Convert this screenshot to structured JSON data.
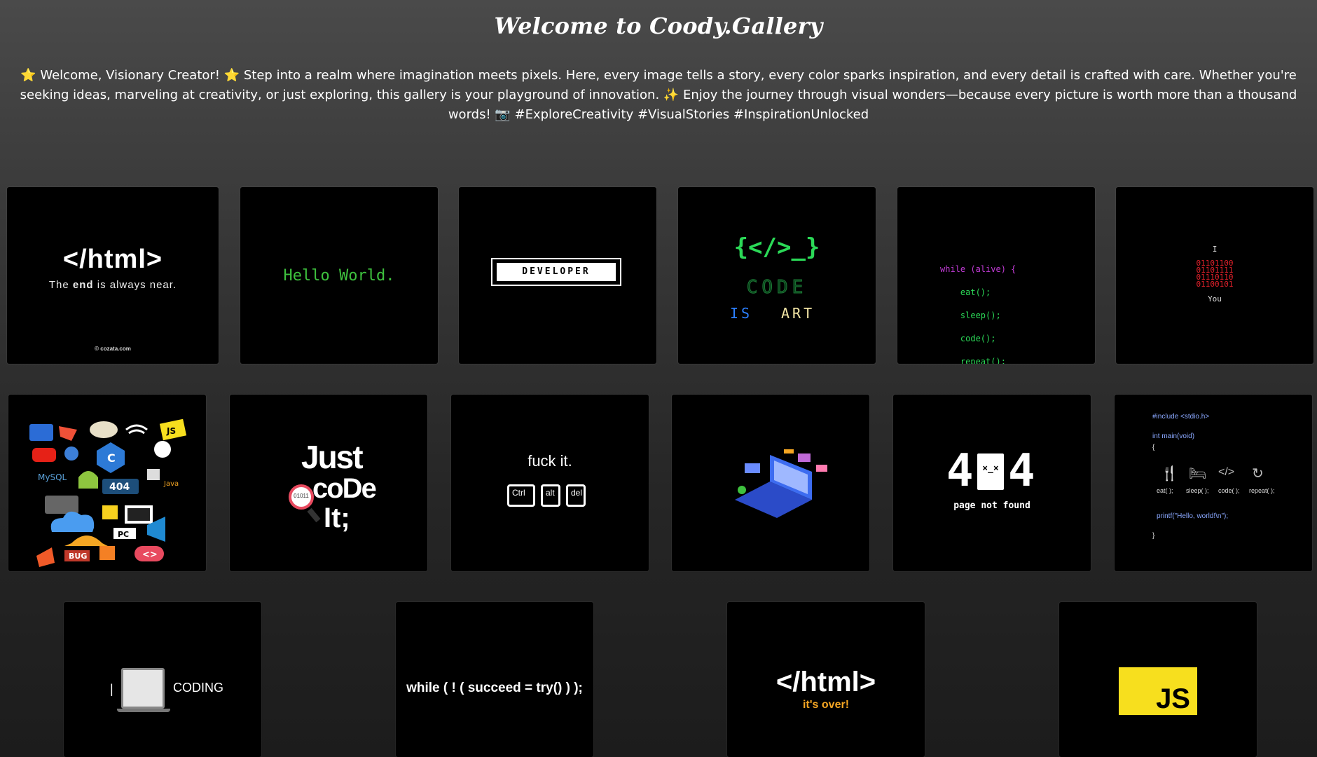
{
  "header": {
    "title": "Welcome to Coody.Gallery",
    "intro": "⭐ Welcome, Visionary Creator! ⭐ Step into a realm where imagination meets pixels. Here, every image tells a story, every color sparks inspiration, and every detail is crafted with care. Whether you're seeking ideas, marveling at creativity, or just exploring, this gallery is your playground of innovation. ✨ Enjoy the journey through visual wonders—because every picture is worth more than a thousand words! 📷 #ExploreCreativity #VisualStories #InspirationUnlocked"
  },
  "gallery": {
    "t1": {
      "big": "</html>",
      "sub_pre": "The ",
      "sub_bold": "end",
      "sub_post": " is always near.",
      "footer": "© cozata.com"
    },
    "t2": {
      "text": "Hello World."
    },
    "t3": {
      "label": "DEVELOPER"
    },
    "t4": {
      "symbol": "{</>_}",
      "word1": "CODE",
      "word2": "IS",
      "word3": "ART"
    },
    "t5": {
      "lines": [
        "while (alive) {",
        "    eat();",
        "    sleep();",
        "    code();",
        "    repeat();",
        "}"
      ]
    },
    "t6": {
      "top": "I",
      "binary": [
        "01101100",
        "01101111",
        "01110110",
        "01100101"
      ],
      "bottom": "You"
    },
    "t7": {
      "badges": [
        "404",
        "BUG",
        "PC",
        "JS",
        "C",
        "MySQL",
        "Java"
      ]
    },
    "t8": {
      "line1": "Just",
      "line2": "coDe",
      "line3": "It;",
      "lens": "01011"
    },
    "t9": {
      "caption": "fuck it.",
      "keys": [
        "Ctrl",
        "alt",
        "del"
      ]
    },
    "t10": {},
    "t11": {
      "digit1": "4",
      "digit2": "4",
      "caption": "page not found"
    },
    "t12": {
      "include": "#include <stdio.h>",
      "main": "int main(void)",
      "open": "{",
      "labels": [
        "eat( );",
        "sleep( );",
        "code( );",
        "repeat( );"
      ],
      "printf": "printf(\"Hello, world!\\n\");",
      "close": "}"
    },
    "t13": {
      "word": "CODING",
      "cursor": "|"
    },
    "t14": {
      "code": "while ( ! ( succeed = try() ) );"
    },
    "t15": {
      "big": "</html>",
      "sub": "it's over!"
    },
    "t16": {
      "logo": "JS"
    }
  },
  "colors": {
    "bg_top": "#4a4a4a",
    "bg_bottom": "#1c1c1c",
    "hello_green": "#3ec13e",
    "code_green": "#2bd957",
    "code_blue": "#2b7fff",
    "binary_red": "#e0202a",
    "purple": "#c23bd6",
    "js_yellow": "#f7df1e",
    "orange": "#f5a623"
  }
}
